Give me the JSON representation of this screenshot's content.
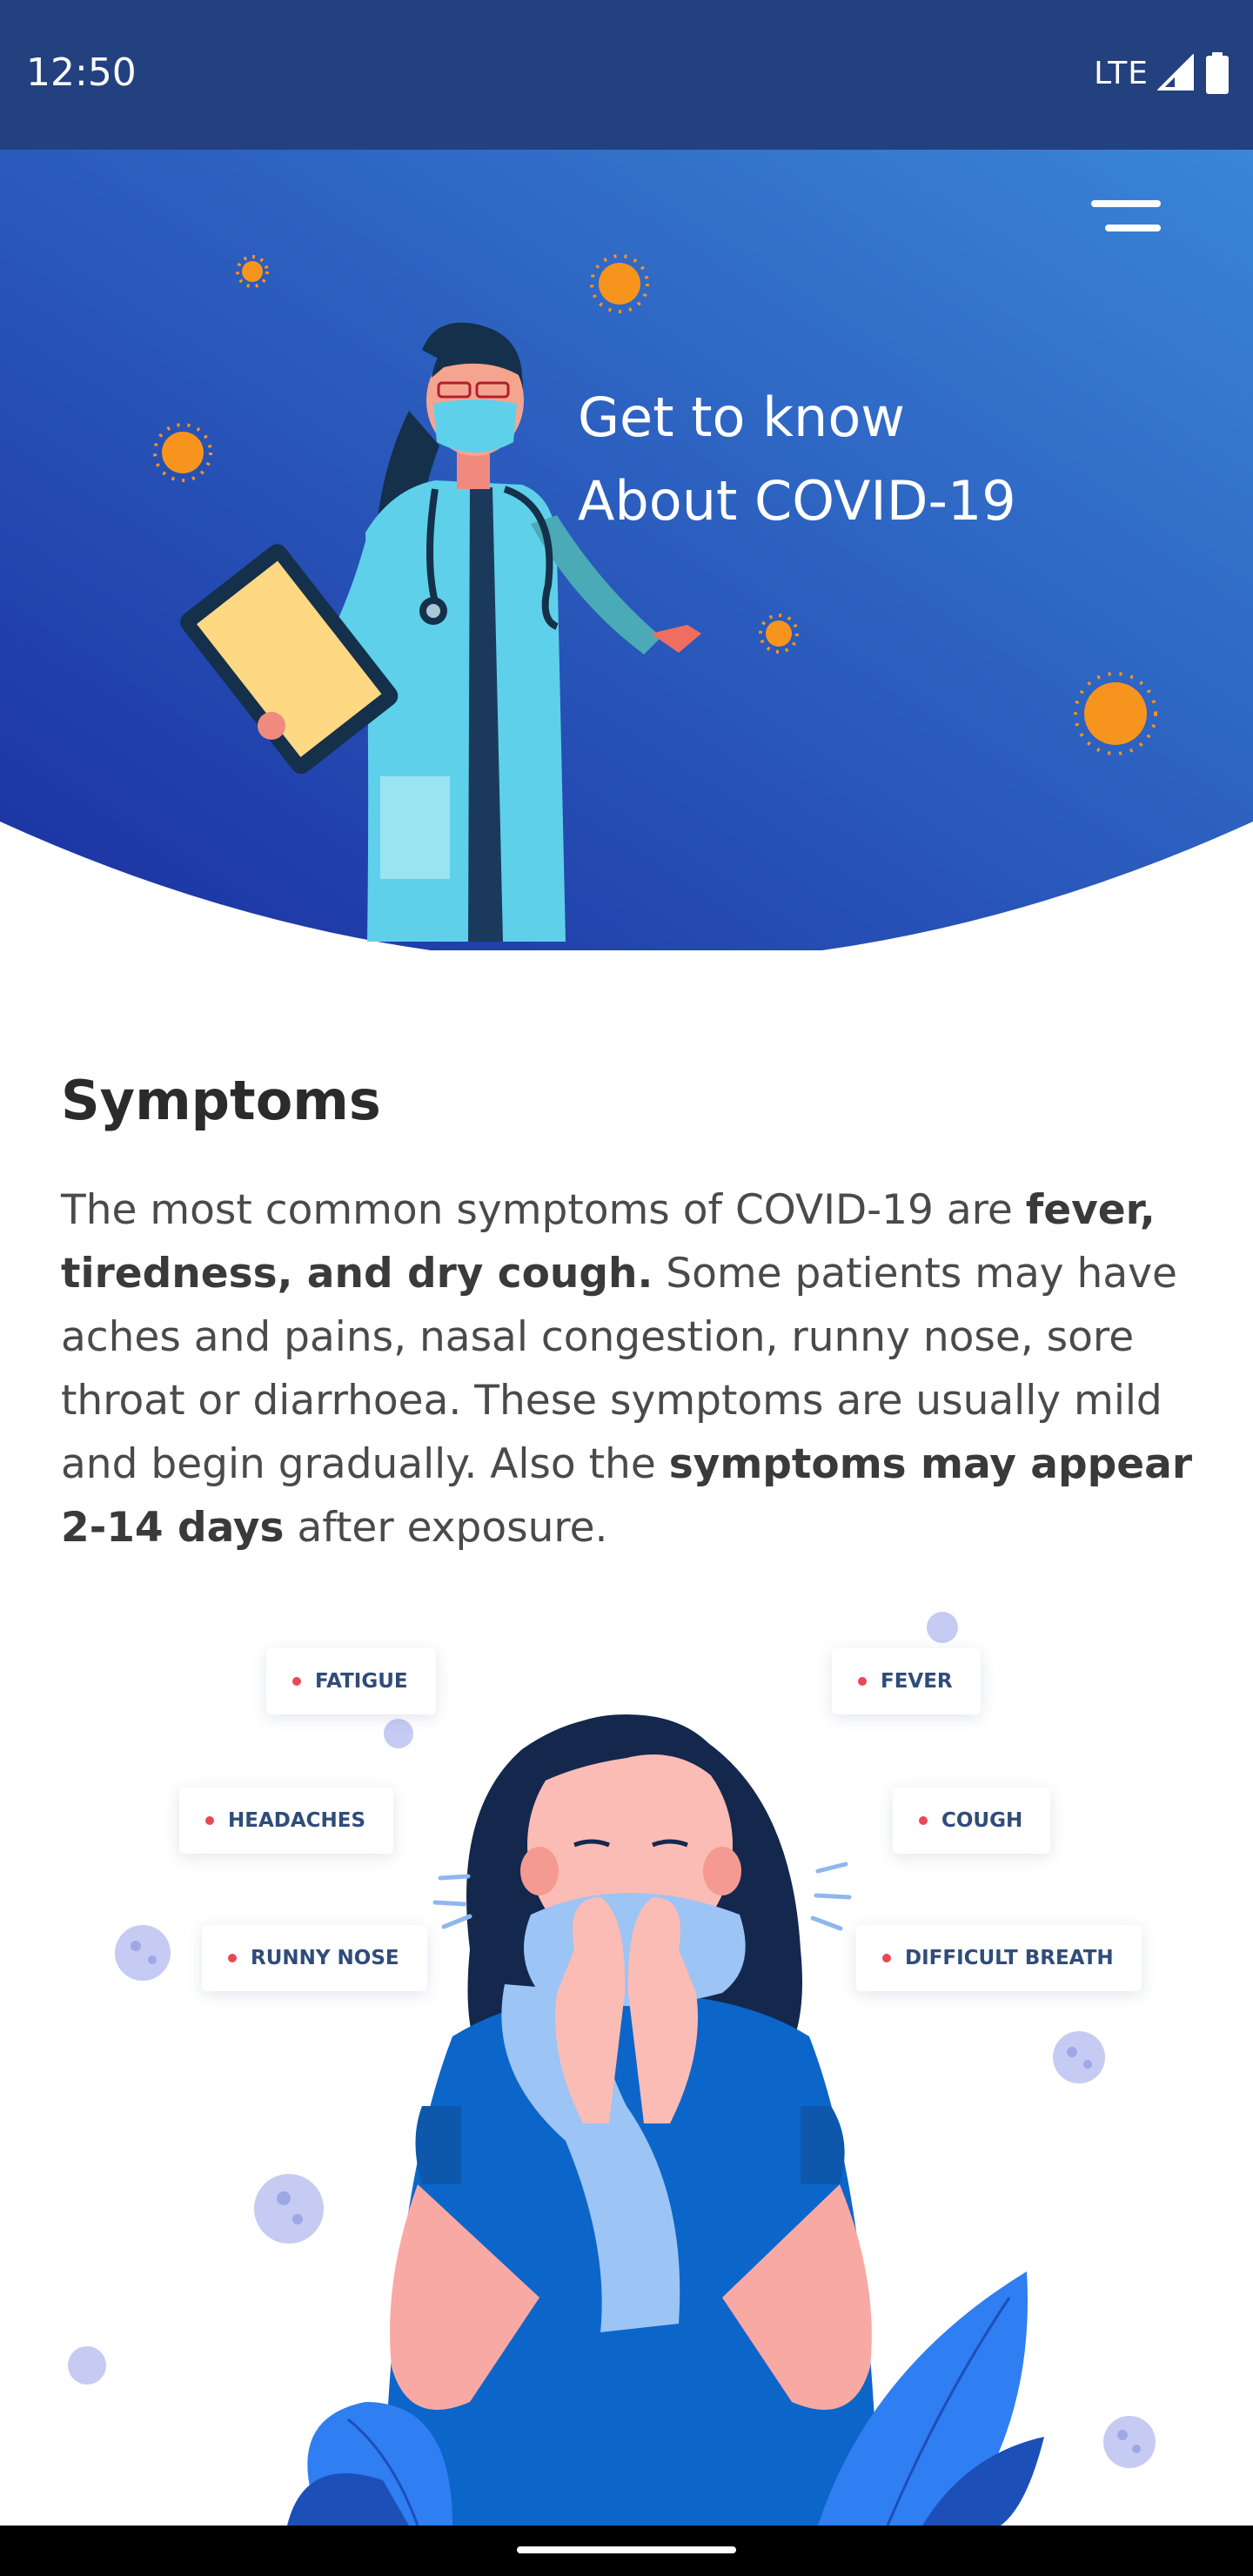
{
  "status_bar": {
    "time": "12:50",
    "network": "LTE",
    "icons": [
      "signal-icon",
      "battery-icon"
    ]
  },
  "hero": {
    "title_line1": "Get to know",
    "title_line2": "About COVID-19",
    "menu_icon": "hamburger-menu-icon",
    "colors": {
      "gradient_start": "#1a2fa0",
      "gradient_end": "#3a86d8"
    }
  },
  "symptoms": {
    "heading": "Symptoms",
    "p1": "The most common symptoms of COVID-19 are ",
    "b1": "fever, tiredness, and dry cough.",
    "p2": " Some patients may have aches and pains, nasal congestion, runny nose, sore throat or diarrhoea. These symptoms are usually mild and begin gradually. Also the ",
    "b2": "symptoms may appear 2-14 days",
    "p3": " after exposure."
  },
  "symptom_tags": {
    "fatigue": "FATIGUE",
    "fever": "FEVER",
    "headaches": "HEADACHES",
    "cough": "COUGH",
    "runny_nose": "RUNNY NOSE",
    "difficult_breath": "DIFFICULT BREATH"
  },
  "colors": {
    "accent_dot": "#e84856",
    "heading": "#2b2b2b",
    "body_text": "#4a4a4a"
  }
}
